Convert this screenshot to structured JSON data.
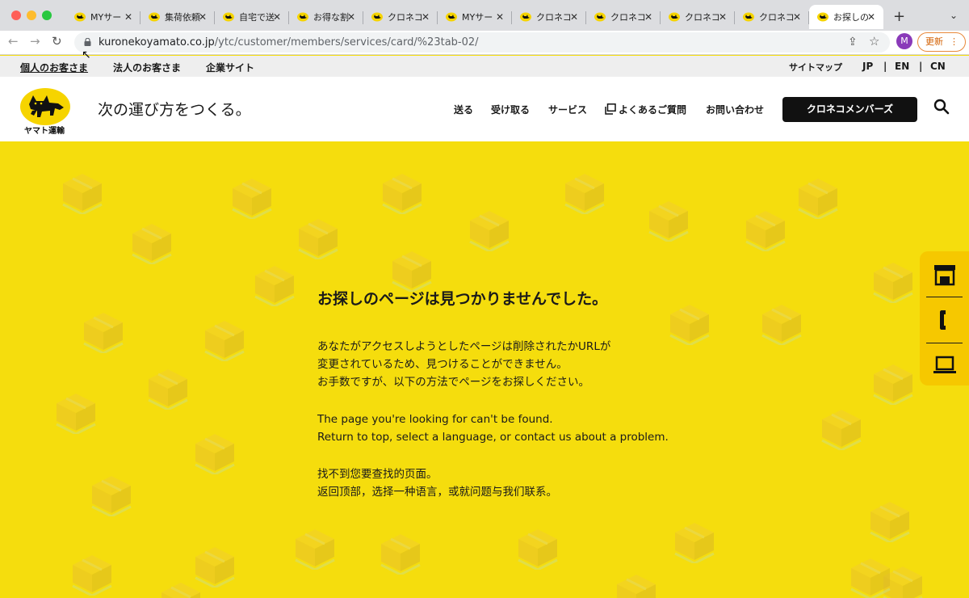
{
  "browser": {
    "tabs": [
      {
        "title": "MYサー",
        "active": false
      },
      {
        "title": "集荷依頼",
        "active": false
      },
      {
        "title": "自宅で送",
        "active": false
      },
      {
        "title": "お得な割",
        "active": false
      },
      {
        "title": "クロネコ",
        "active": false
      },
      {
        "title": "MYサー",
        "active": false
      },
      {
        "title": "クロネコ",
        "active": false
      },
      {
        "title": "クロネコ",
        "active": false
      },
      {
        "title": "クロネコ",
        "active": false
      },
      {
        "title": "クロネコ",
        "active": false
      },
      {
        "title": "お探しの",
        "active": true
      }
    ],
    "url_host": "kuronekoyamato.co.jp",
    "url_path": "/ytc/customer/members/services/card/%23tab-02/",
    "profile_initial": "M",
    "update_label": "更新"
  },
  "utility_nav": {
    "left": [
      "個人のお客さま",
      "法人のお客さま",
      "企業サイト"
    ],
    "sitemap": "サイトマップ",
    "languages": [
      "JP",
      "EN",
      "CN"
    ],
    "separator": "|"
  },
  "header": {
    "logo_text": "ヤマト運輸",
    "tagline": "次の運び方をつくる。",
    "nav": [
      "送る",
      "受け取る",
      "サービス",
      "よくあるご質問",
      "お問い合わせ"
    ],
    "member_button": "クロネコメンバーズ"
  },
  "error": {
    "title": "お探しのページは見つかりませんでした。",
    "ja": [
      "あなたがアクセスしようとしたページは削除されたかURLが",
      "変更されているため、見つけることができません。",
      "お手数ですが、以下の方法でページをお探しください。"
    ],
    "en": [
      "The page you're looking for can't be found.",
      "Return to top, select a language, or contact us about a problem."
    ],
    "zh": [
      "找不到您要查找的页面。",
      "返回顶部，选择一种语言，或就问题与我们联系。"
    ]
  },
  "side_rail": {
    "icons": [
      "store-icon",
      "phone-icon",
      "laptop-icon"
    ]
  },
  "colors": {
    "brand_yellow": "#f5dd0d",
    "rail_yellow": "#f6c800",
    "dark": "#111111"
  }
}
